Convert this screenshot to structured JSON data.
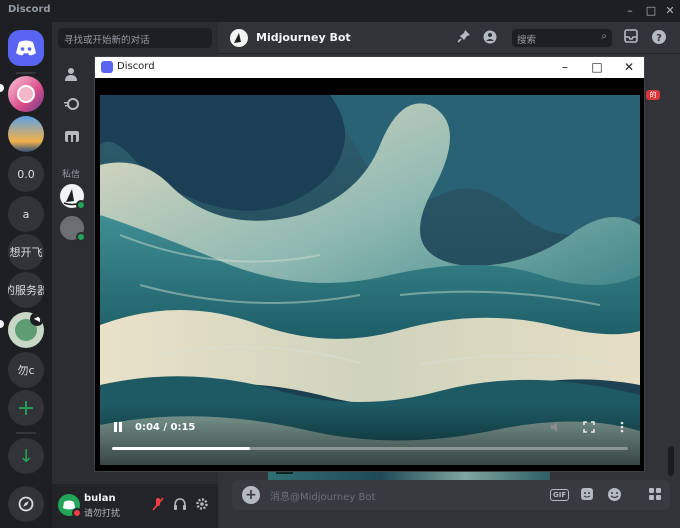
{
  "window": {
    "app_name": "Discord",
    "controls": [
      "–",
      "□",
      "✕"
    ]
  },
  "guilds": [
    {
      "label": "",
      "icon": "discord-icon",
      "kind": "home"
    },
    {
      "label": "",
      "icon": "anime-avatar-icon",
      "kind": "image"
    },
    {
      "label": "",
      "icon": "sunset-icon",
      "kind": "image"
    },
    {
      "label": "0.0",
      "kind": "text"
    },
    {
      "label": "a",
      "kind": "text"
    },
    {
      "label": "想开飞",
      "kind": "text"
    },
    {
      "label": "的服务器",
      "kind": "text"
    },
    {
      "label": "",
      "icon": "speaker-icon",
      "kind": "image"
    },
    {
      "label": "勿c",
      "kind": "text"
    },
    {
      "label": "+",
      "icon": "add-server-icon",
      "kind": "action"
    },
    {
      "label": "↓",
      "icon": "download-icon",
      "kind": "action"
    },
    {
      "label": "",
      "icon": "compass-icon",
      "kind": "action"
    }
  ],
  "sidebar": {
    "search_placeholder": "寻找或开始新的对话",
    "dm_header": "私信",
    "user": {
      "name": "bulan",
      "status": "请勿打扰"
    }
  },
  "channel": {
    "title": "Midjourney Bot",
    "search_placeholder": "搜索",
    "message_placeholder": "消息@Midjourney Bot",
    "embed_gif_label": "GIF",
    "gif_button": "GIF",
    "red_tag": "的"
  },
  "popup": {
    "title": "Discord",
    "controls": [
      "–",
      "□",
      "✕"
    ],
    "video": {
      "time": "0:04 / 0:15",
      "progress": 0.267
    }
  },
  "colors": {
    "blurple": "#5865f2",
    "green": "#23a559",
    "dnd_red": "#f23f43"
  }
}
